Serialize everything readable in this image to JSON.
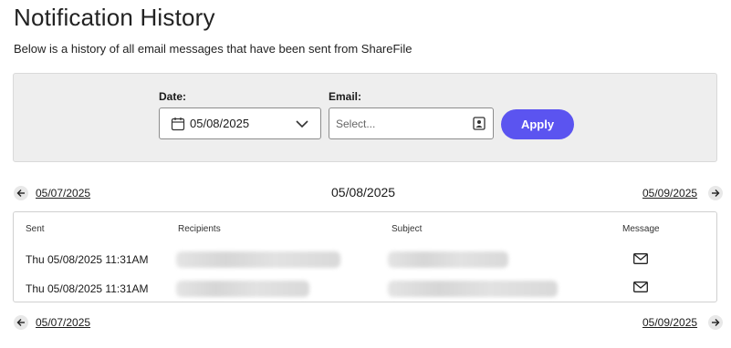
{
  "page": {
    "title": "Notification History",
    "subtitle": "Below is a history of all email messages that have been sent from ShareFile"
  },
  "filters": {
    "date_label": "Date:",
    "date_value": "05/08/2025",
    "email_label": "Email:",
    "email_placeholder": "Select...",
    "apply_label": "Apply"
  },
  "navigation": {
    "prev_date": "05/07/2025",
    "current_date": "05/08/2025",
    "next_date": "05/09/2025"
  },
  "table": {
    "columns": [
      "Sent",
      "Recipients",
      "Subject",
      "Message"
    ],
    "rows": [
      {
        "sent": "Thu 05/08/2025 11:31AM"
      },
      {
        "sent": "Thu 05/08/2025 11:31AM"
      }
    ]
  },
  "icons": {
    "date": "calendar-icon",
    "dropdown": "chevron-down-icon",
    "contact": "contact-book-icon",
    "prev": "arrow-left-icon",
    "next": "arrow-right-icon",
    "message": "envelope-icon"
  },
  "colors": {
    "accent": "#5b54f0",
    "panel": "#eeeeee"
  }
}
